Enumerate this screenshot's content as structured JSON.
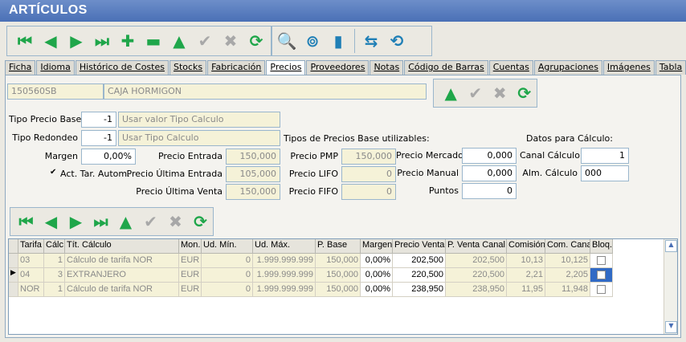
{
  "window": {
    "title": "ARTÍCULOS"
  },
  "toolbar_main": [
    {
      "icon": "first-icon",
      "glyph": "⏮",
      "enabled": true
    },
    {
      "icon": "prev-icon",
      "glyph": "◀",
      "enabled": true
    },
    {
      "icon": "next-icon",
      "glyph": "▶",
      "enabled": true
    },
    {
      "icon": "last-icon",
      "glyph": "⏭",
      "enabled": true
    },
    {
      "icon": "add-icon",
      "glyph": "✚",
      "enabled": true
    },
    {
      "icon": "delete-icon",
      "glyph": "▬",
      "enabled": true
    },
    {
      "icon": "edit-icon",
      "glyph": "▲",
      "enabled": true
    },
    {
      "icon": "confirm-icon",
      "glyph": "✔",
      "enabled": false
    },
    {
      "icon": "cancel-icon",
      "glyph": "✖",
      "enabled": false
    },
    {
      "icon": "refresh-icon",
      "glyph": "⟳",
      "enabled": true
    }
  ],
  "toolbar_right": [
    {
      "icon": "search-icon",
      "glyph": "🔍"
    },
    {
      "icon": "signal-icon",
      "glyph": "⊚"
    },
    {
      "icon": "exit-door-icon",
      "glyph": "▮"
    },
    {
      "icon": "transfer-icon",
      "glyph": "⇆"
    },
    {
      "icon": "sync-icon",
      "glyph": "⟲"
    }
  ],
  "tabs": [
    "Ficha",
    "Idioma",
    "Histórico de Costes",
    "Stocks",
    "Fabricación",
    "Precios",
    "Proveedores",
    "Notas",
    "Código de Barras",
    "Cuentas",
    "Agrupaciones",
    "Imágenes",
    "Tabla"
  ],
  "active_tab": "Precios",
  "article": {
    "code": "150560SB",
    "name": "CAJA HORMIGON"
  },
  "form": {
    "tipo_precio_base_label": "Tipo Precio Base",
    "tipo_precio_base_value": "-1",
    "tipo_precio_base_desc": "Usar valor Tipo Calculo",
    "tipo_redondeo_label": "Tipo Redondeo",
    "tipo_redondeo_value": "-1",
    "tipo_redondeo_desc": "Usar Tipo Calculo",
    "margen_label": "Margen",
    "margen_value": "0,00%",
    "act_tar_label": "Act. Tar. Autom.",
    "act_tar_checked": true,
    "precio_entrada_label": "Precio Entrada",
    "precio_entrada_value": "150,000",
    "precio_ultima_entrada_label": "Precio Última Entrada",
    "precio_ultima_entrada_value": "105,000",
    "precio_ultima_venta_label": "Precio Última Venta",
    "precio_ultima_venta_value": "150,000",
    "tipos_heading": "Tipos de Precios Base utilizables:",
    "precio_pmp_label": "Precio PMP",
    "precio_pmp_value": "150,000",
    "precio_lifo_label": "Precio LIFO",
    "precio_lifo_value": "0",
    "precio_fifo_label": "Precio FIFO",
    "precio_fifo_value": "0",
    "precio_mercado_label": "Precio Mercado",
    "precio_mercado_value": "0,000",
    "precio_manual_label": "Precio Manual",
    "precio_manual_value": "0,000",
    "puntos_label": "Puntos",
    "puntos_value": "0",
    "datos_heading": "Datos para Cálculo:",
    "canal_calculo_label": "Canal Cálculo",
    "canal_calculo_value": "1",
    "alm_calculo_label": "Alm. Cálculo",
    "alm_calculo_value": "000"
  },
  "grid": {
    "columns": [
      "Tarifa",
      "Cálc.",
      "Tít. Cálculo",
      "Mon.",
      "Ud. Mín.",
      "Ud. Máx.",
      "P. Base",
      "Margen",
      "Precio Venta",
      "P. Venta Canal",
      "Comisión",
      "Com. Canal",
      "Bloq."
    ],
    "rows": [
      [
        "03",
        "1",
        "Cálculo de tarifa NOR",
        "EUR",
        "0",
        "1.999.999.999",
        "150,000",
        "0,00%",
        "202,500",
        "202,500",
        "10,13",
        "10,125"
      ],
      [
        "04",
        "3",
        "EXTRANJERO",
        "EUR",
        "0",
        "1.999.999.999",
        "150,000",
        "0,00%",
        "220,500",
        "220,500",
        "2,21",
        "2,205"
      ],
      [
        "NOR",
        "1",
        "Cálculo de tarifa NOR",
        "EUR",
        "0",
        "1.999.999.999",
        "150,000",
        "0,00%",
        "238,950",
        "238,950",
        "11,95",
        "11,948"
      ]
    ],
    "selected_row": 1
  },
  "colors": {
    "accent_green": "#1fa64a",
    "title_blue": "#4a70b6",
    "readonly_yellow": "#f5f2d8"
  }
}
